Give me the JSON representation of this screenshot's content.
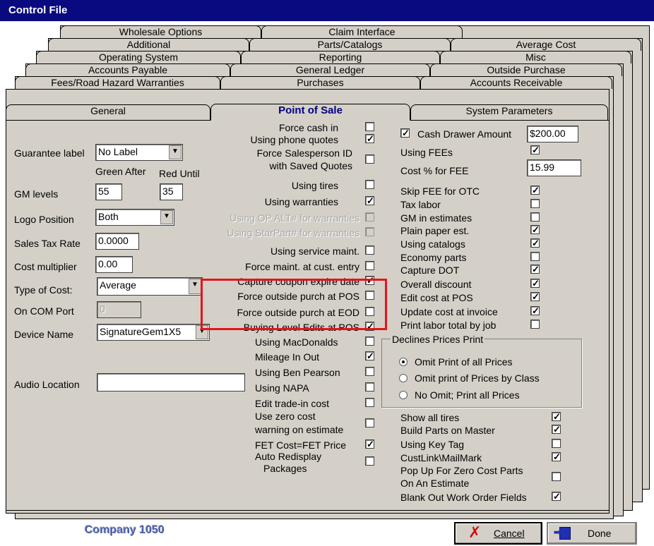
{
  "window": {
    "title": "Control File"
  },
  "tabs": {
    "row1": [
      "Wholesale Options",
      "Claim Interface"
    ],
    "row2": [
      "Additional",
      "Parts/Catalogs",
      "Average Cost"
    ],
    "row3": [
      "Operating System",
      "Reporting",
      "Misc"
    ],
    "row4": [
      "Accounts Payable",
      "General Ledger",
      "Outside Purchase"
    ],
    "row5": [
      "Fees/Road Hazard Warranties",
      "Purchases",
      "Accounts Receivable"
    ],
    "row6": [
      "General",
      "Point of Sale",
      "System Parameters"
    ],
    "active": "Point of Sale"
  },
  "left": {
    "guarantee_label": "Guarantee label",
    "guarantee_value": "No Label",
    "green_after": "Green After",
    "red_until": "Red Until",
    "gm_levels": "GM levels",
    "gm_green": "55",
    "gm_red": "35",
    "logo_position": "Logo Position",
    "logo_value": "Both",
    "sales_tax_rate": "Sales Tax Rate",
    "sales_tax_value": "0.0000",
    "cost_multiplier": "Cost multiplier",
    "cost_multiplier_value": "0.00",
    "type_of_cost": "Type of Cost:",
    "type_of_cost_value": "Average",
    "com_port": "On COM Port",
    "com_port_value": "0",
    "device_name": "Device Name",
    "device_value": "SignatureGem1X5",
    "audio_location": "Audio Location",
    "audio_value": ""
  },
  "middle": {
    "items": [
      {
        "label": "Force cash in",
        "checked": false
      },
      {
        "label": "Using phone quotes",
        "checked": true
      },
      {
        "label": "Force Salesperson ID",
        "checked": false
      },
      {
        "label": "with Saved Quotes",
        "checked": false
      },
      {
        "label": "Using tires",
        "checked": false
      },
      {
        "label": "Using warranties",
        "checked": true
      },
      {
        "label": "Using OP ALT# for warranties",
        "checked": false,
        "disabled": true
      },
      {
        "label": "Using StarPart# for warranties",
        "checked": false,
        "disabled": true
      },
      {
        "label": "Using service maint.",
        "checked": false
      },
      {
        "label": "Force maint. at cust. entry",
        "checked": false
      },
      {
        "label": "Capture coupon expire date",
        "checked": true
      },
      {
        "label": "Force outside purch at POS",
        "checked": false
      },
      {
        "label": "Force outside purch at EOD",
        "checked": false
      },
      {
        "label": "Buying Level Edits at POS",
        "checked": true
      },
      {
        "label": "Using MacDonalds",
        "checked": false
      },
      {
        "label": "Mileage In Out",
        "checked": true
      },
      {
        "label": "Using Ben Pearson",
        "checked": false
      },
      {
        "label": "Using NAPA",
        "checked": false
      },
      {
        "label": "Edit trade-in cost",
        "checked": false
      },
      {
        "label": "Use zero cost",
        "checked": false
      },
      {
        "label": "warning on estimate",
        "checked": false
      },
      {
        "label": "FET Cost=FET Price",
        "checked": true
      },
      {
        "label": "Auto Redisplay",
        "checked": false
      },
      {
        "label": "Packages",
        "checked": false
      }
    ]
  },
  "right": {
    "cash_drawer_label": "Cash Drawer Amount",
    "cash_drawer_checked": true,
    "cash_drawer_value": "$200.00",
    "using_fees": "Using FEEs",
    "using_fees_checked": true,
    "cost_pct_fee": "Cost % for FEE",
    "cost_pct_value": "15.99",
    "items": [
      {
        "label": "Skip FEE for OTC",
        "checked": true
      },
      {
        "label": "Tax labor",
        "checked": false
      },
      {
        "label": "GM in estimates",
        "checked": false
      },
      {
        "label": "Plain paper est.",
        "checked": true
      },
      {
        "label": "Using catalogs",
        "checked": true
      },
      {
        "label": "Economy parts",
        "checked": false
      },
      {
        "label": "Capture DOT",
        "checked": true
      },
      {
        "label": "Overall discount",
        "checked": true
      },
      {
        "label": "Edit cost at POS",
        "checked": true
      },
      {
        "label": "Update cost at invoice",
        "checked": true
      },
      {
        "label": "Print labor total by job",
        "checked": false
      }
    ],
    "declines_group": "Declines Prices Print",
    "radios": [
      {
        "label": "Omit Print of all Prices",
        "selected": true
      },
      {
        "label": "Omit print of Prices by Class",
        "selected": false
      },
      {
        "label": "No Omit; Print all Prices",
        "selected": false
      }
    ],
    "bottom_items": [
      {
        "label": "Show all tires",
        "checked": true
      },
      {
        "label": "Build Parts on Master",
        "checked": true
      },
      {
        "label": "Using Key Tag",
        "checked": false
      },
      {
        "label": "CustLink\\MailMark",
        "checked": true
      },
      {
        "label": "Pop Up For Zero Cost Parts",
        "checked": false
      },
      {
        "label": "On An Estimate",
        "checked": false
      },
      {
        "label": "Blank Out Work Order Fields",
        "checked": true
      }
    ]
  },
  "footer": {
    "company": "Company 1050",
    "cancel_label": "Cancel",
    "done_label": "Done"
  }
}
